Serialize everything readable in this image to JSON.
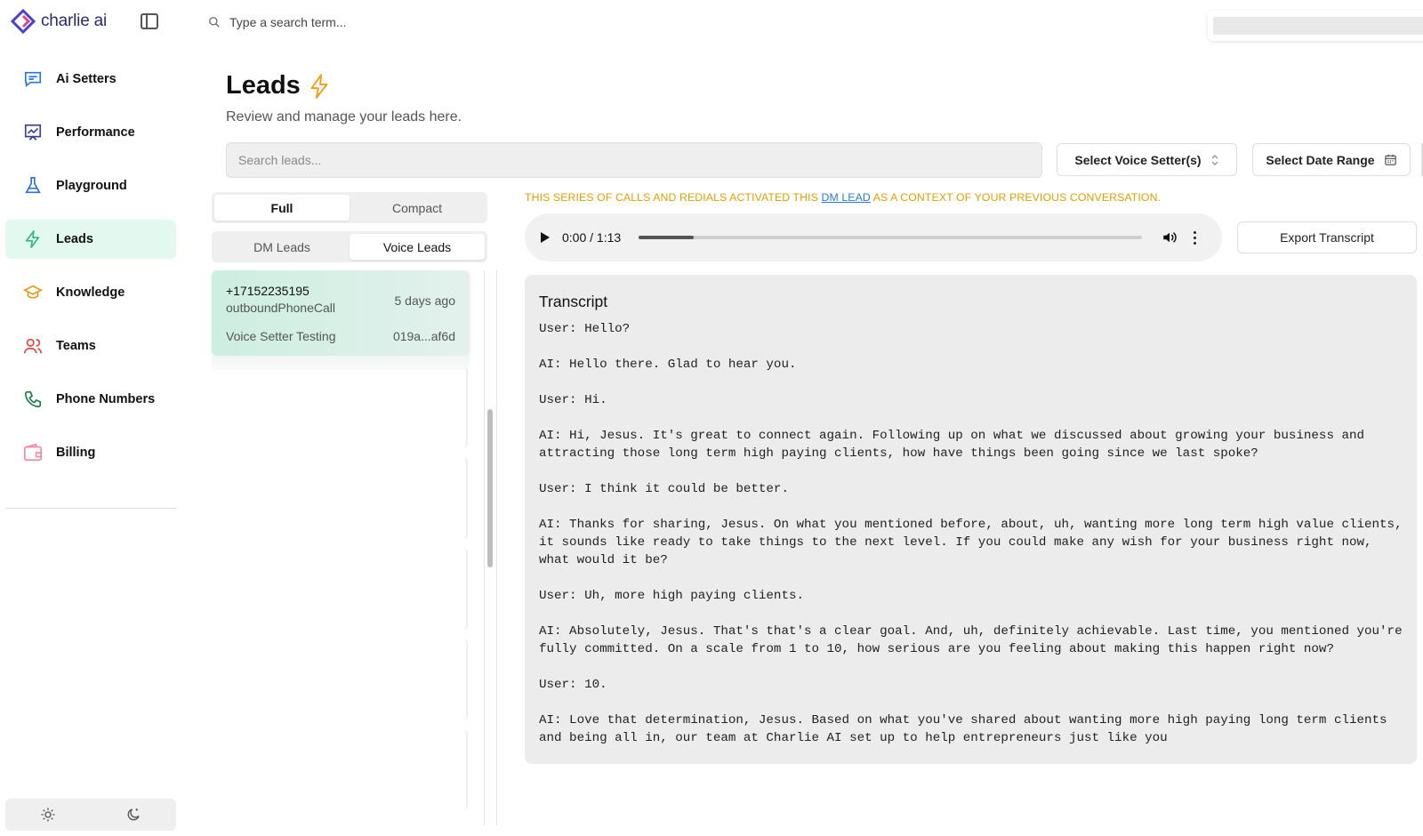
{
  "brand": {
    "name": "charlie ai",
    "accent": "#2b2b72"
  },
  "sidebar": {
    "items": [
      {
        "label": "Ai Setters",
        "icon": "chat-icon",
        "color": "#2a74d8"
      },
      {
        "label": "Performance",
        "icon": "presentation-chart-icon",
        "color": "#3b3b9a"
      },
      {
        "label": "Playground",
        "icon": "flask-icon",
        "color": "#2a74d8"
      },
      {
        "label": "Leads",
        "icon": "lightning-icon",
        "color": "#2fb886",
        "active": true
      },
      {
        "label": "Knowledge",
        "icon": "graduation-cap-icon",
        "color": "#e09a1a"
      },
      {
        "label": "Teams",
        "icon": "users-icon",
        "color": "#e0453a"
      },
      {
        "label": "Phone Numbers",
        "icon": "phone-icon",
        "color": "#1f7a4a"
      },
      {
        "label": "Billing",
        "icon": "wallet-icon",
        "color": "#f08aa0"
      }
    ],
    "theme": {
      "light_icon": "sun-icon",
      "dark_icon": "moon-icon"
    }
  },
  "topbar": {
    "search_placeholder": "Type a search term..."
  },
  "header": {
    "title": "Leads",
    "title_icon": "lightning-icon",
    "subtitle": "Review and manage your leads here."
  },
  "filters": {
    "search_placeholder": "Search leads...",
    "voice_setter_label": "Select Voice Setter(s)",
    "date_range_label": "Select Date Range"
  },
  "view_toggle": {
    "options": [
      "Full",
      "Compact"
    ],
    "selected": "Full"
  },
  "lead_type_toggle": {
    "options": [
      "DM Leads",
      "Voice Leads"
    ],
    "selected": "Voice Leads"
  },
  "leads": [
    {
      "phone": "+17152235195",
      "type": "outboundPhoneCall",
      "time_ago": "5 days ago",
      "setter": "Voice Setter Testing",
      "id": "019a...af6d"
    }
  ],
  "notice": {
    "before": "THIS SERIES OF CALLS AND REDIALS ACTIVATED THIS ",
    "link": "DM LEAD",
    "after": " AS A CONTEXT OF YOUR PREVIOUS CONVERSATION."
  },
  "player": {
    "time": "0:00 / 1:13",
    "progress": 0.11
  },
  "export_label": "Export Transcript",
  "transcript": {
    "title": "Transcript",
    "lines": [
      "User: Hello?",
      "AI: Hello there. Glad to hear you.",
      "User: Hi.",
      "AI: Hi, Jesus. It's great to connect again. Following up on what we discussed about growing your business and attracting those long term high paying clients, how have things been going since we last spoke?",
      "User: I think it could be better.",
      "AI: Thanks for sharing, Jesus. On what you mentioned before, about, uh, wanting more long term high value clients, it sounds like ready to take things to the next level. If you could make any wish for your business right now, what would it be?",
      "User: Uh, more high paying clients.",
      "AI: Absolutely, Jesus. That's that's a clear goal. And, uh, definitely achievable. Last time, you mentioned you're fully committed. On a scale from 1 to 10, how serious are you feeling about making this happen right now?",
      "User: 10.",
      "AI: Love that determination, Jesus. Based on what you've shared about wanting more high paying long term clients and being all in, our team at Charlie AI set up to help entrepreneurs just like you"
    ]
  }
}
